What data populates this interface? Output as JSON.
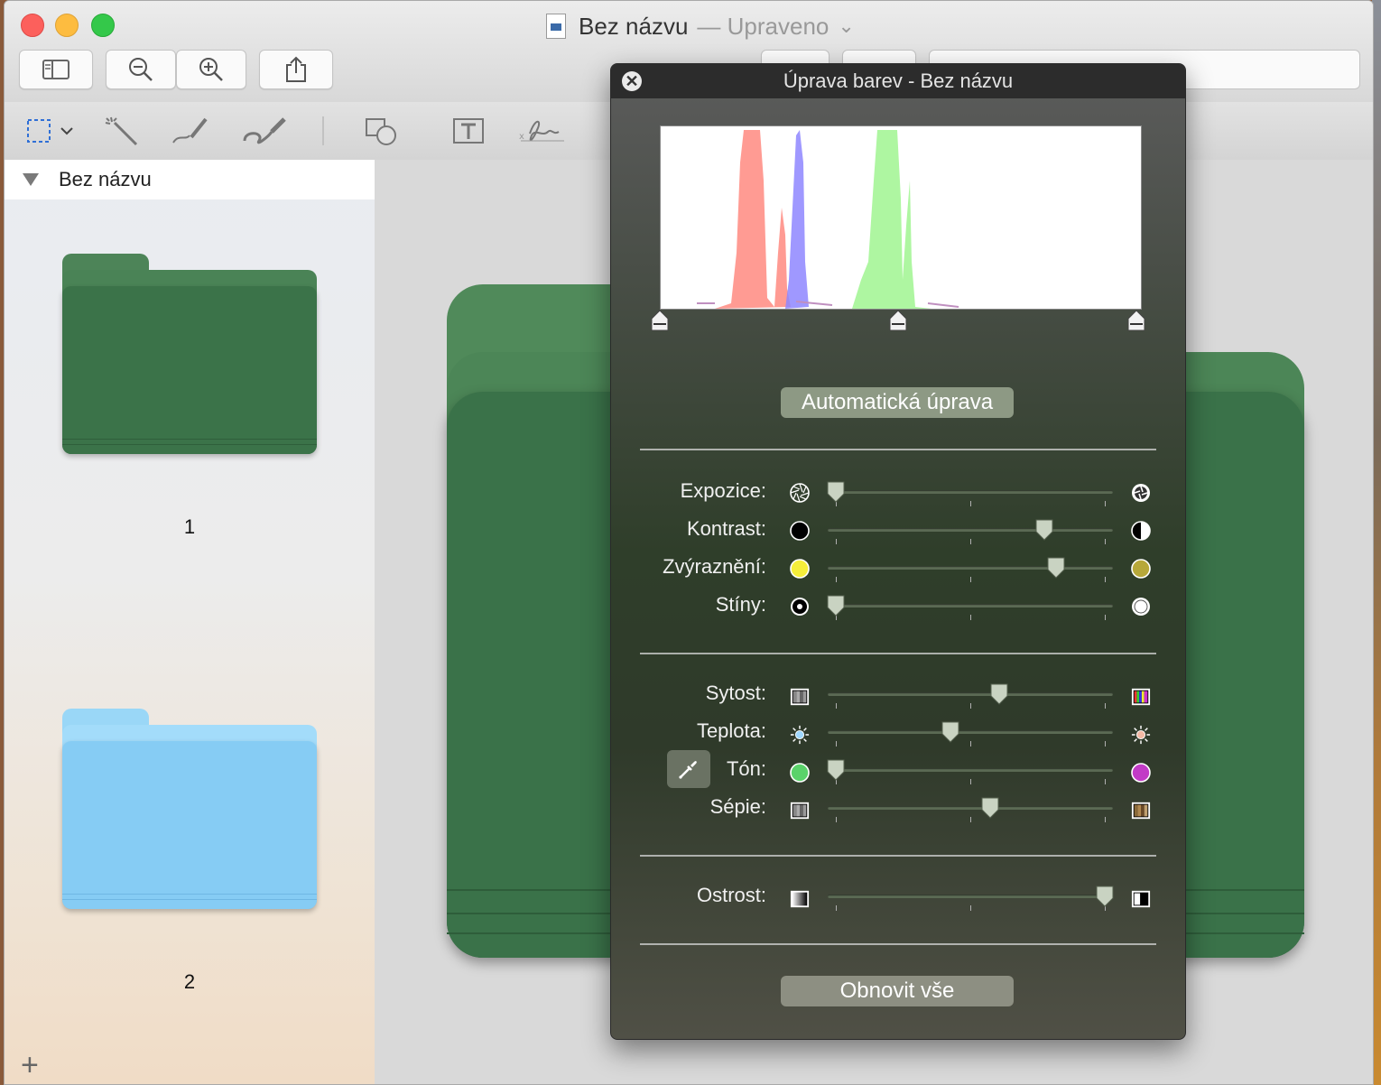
{
  "window": {
    "title": "Bez názvu",
    "subtitle": "— Upraveno",
    "subtitle_chevron": "⌄"
  },
  "toolbar": {
    "sidebar_icon": "sidebar-icon",
    "zoom_out_icon": "zoom-out-icon",
    "zoom_in_icon": "zoom-in-icon",
    "share_icon": "share-icon"
  },
  "markup": {
    "tools": [
      "rect-select-icon",
      "instant-alpha-icon",
      "sketch-icon",
      "draw-icon",
      "shapes-icon",
      "text-icon",
      "sign-icon"
    ]
  },
  "sidebar": {
    "header": "Bez názvu",
    "items": [
      {
        "label": "1",
        "color": "#3f7a4c"
      },
      {
        "label": "2",
        "color": "#8dd0f5"
      }
    ],
    "add_icon": "+"
  },
  "panel": {
    "title": "Úprava barev - Bez názvu",
    "close_icon": "✕",
    "auto_button": "Automatická úprava",
    "reset_button": "Obnovit vše",
    "groups": [
      [
        {
          "key": "expozice",
          "label": "Expozice:",
          "value": 0.03,
          "left_icon": "aperture-icon",
          "right_icon": "aperture-bright-icon"
        },
        {
          "key": "kontrast",
          "label": "Kontrast:",
          "value": 0.76,
          "left_icon": "circle-black-icon",
          "right_icon": "half-circle-icon"
        },
        {
          "key": "zvyrazneni",
          "label": "Zvýraznění:",
          "value": 0.8,
          "left_icon": "circle-yellow-icon",
          "right_icon": "circle-olive-icon"
        },
        {
          "key": "stiny",
          "label": "Stíny:",
          "value": 0.03,
          "left_icon": "dot-circle-icon",
          "right_icon": "circle-white-icon"
        }
      ],
      [
        {
          "key": "sytost",
          "label": "Sytost:",
          "value": 0.6,
          "left_icon": "gray-swatch-icon",
          "right_icon": "rainbow-swatch-icon"
        },
        {
          "key": "teplota",
          "label": "Teplota:",
          "value": 0.43,
          "left_icon": "sun-cool-icon",
          "right_icon": "sun-warm-icon"
        },
        {
          "key": "ton",
          "label": "Tón:",
          "value": 0.03,
          "left_icon": "circle-green-icon",
          "right_icon": "circle-magenta-icon"
        },
        {
          "key": "sepie",
          "label": "Sépie:",
          "value": 0.57,
          "left_icon": "gray-swatch-icon",
          "right_icon": "sepia-swatch-icon"
        }
      ],
      [
        {
          "key": "ostrost",
          "label": "Ostrost:",
          "value": 0.97,
          "left_icon": "gradient-swatch-icon",
          "right_icon": "sharp-swatch-icon"
        }
      ]
    ],
    "eyedropper_icon": "eyedropper-icon"
  },
  "colors": {
    "folder_green": "#3f7a4c",
    "folder_blue": "#8dd0f5",
    "panel_bg": "#2f3e2a"
  }
}
